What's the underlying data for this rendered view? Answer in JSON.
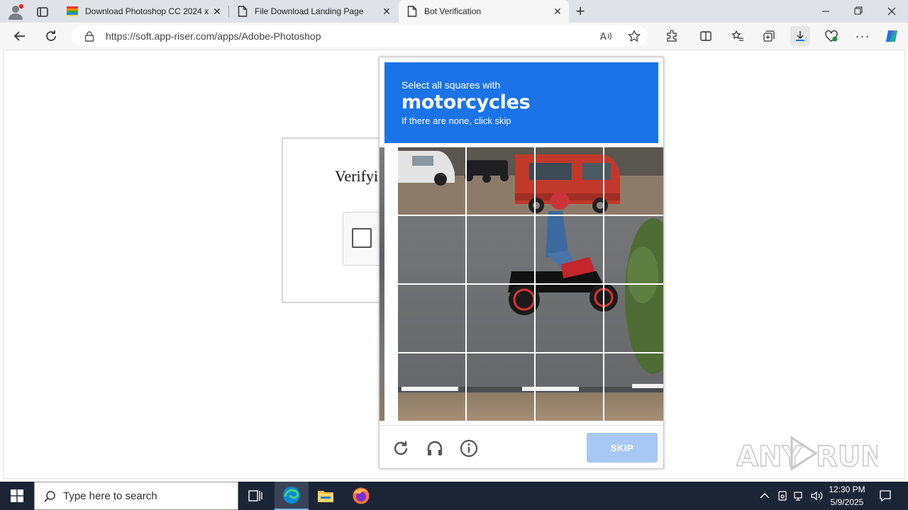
{
  "browser": {
    "tabs": [
      {
        "label": "Download Photoshop CC 2024 x",
        "icon": "colorful-flag-icon",
        "active": false
      },
      {
        "label": "File Download Landing Page",
        "icon": "page-icon",
        "active": false
      },
      {
        "label": "Bot Verification",
        "icon": "page-icon",
        "active": true
      }
    ],
    "url": "https://soft.app-riser.com/apps/Adobe-Photoshop"
  },
  "page": {
    "verify_title": "Verifyi"
  },
  "captcha": {
    "instruction": "Select all squares with",
    "target": "motorcycles",
    "hint": "If there are none, click skip",
    "skip_label": "SKIP",
    "header_color": "#1a73e8",
    "skip_color": "#a6c8f2"
  },
  "watermark": {
    "text": "ANY RUN"
  },
  "taskbar": {
    "search_placeholder": "Type here to search",
    "time": "12:30 PM",
    "date": "5/9/2025"
  }
}
